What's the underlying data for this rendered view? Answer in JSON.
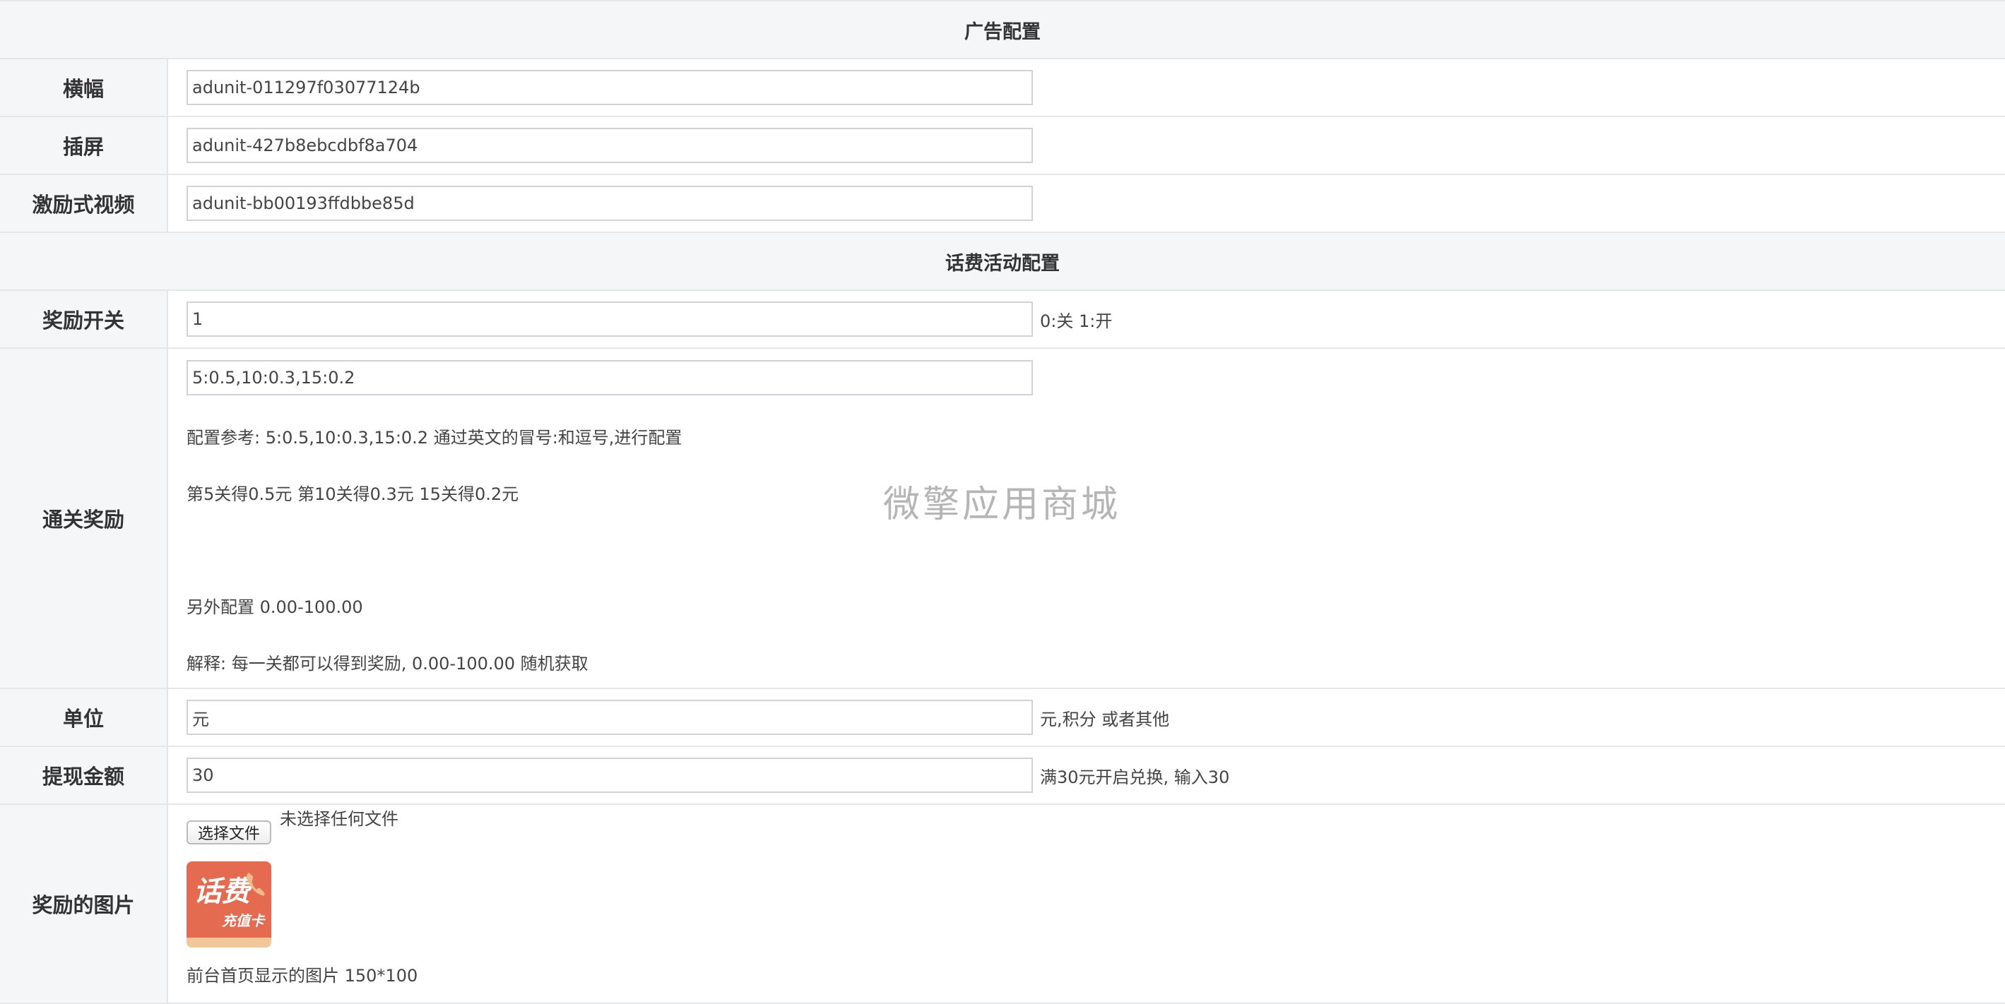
{
  "ad_section": {
    "title": "广告配置",
    "rows": [
      {
        "label": "横幅",
        "value": "adunit-011297f03077124b"
      },
      {
        "label": "插屏",
        "value": "adunit-427b8ebcdbf8a704"
      },
      {
        "label": "激励式视频",
        "value": "adunit-bb00193ffdbbe85d"
      }
    ]
  },
  "fee_section": {
    "title": "话费活动配置",
    "reward_switch": {
      "label": "奖励开关",
      "value": "1",
      "hint": "0:关 1:开"
    },
    "level_reward": {
      "label": "通关奖励",
      "value": "5:0.5,10:0.3,15:0.2",
      "note1": "配置参考: 5:0.5,10:0.3,15:0.2 通过英文的冒号:和逗号,进行配置",
      "note2": "第5关得0.5元 第10关得0.3元 15关得0.2元",
      "note3": "另外配置 0.00-100.00",
      "note4": "解释: 每一关都可以得到奖励, 0.00-100.00 随机获取"
    },
    "unit": {
      "label": "单位",
      "value": "元",
      "hint": "元,积分 或者其他"
    },
    "withdraw": {
      "label": "提现金额",
      "value": "30",
      "hint": "满30元开启兑换, 输入30"
    },
    "reward_image": {
      "label": "奖励的图片",
      "choose_button": "选择文件",
      "no_file": "未选择任何文件",
      "thumb_text_main": "话费",
      "thumb_text_sub": "充值卡",
      "note": "前台首页显示的图片 150*100"
    }
  },
  "watermark": "微擎应用商城"
}
